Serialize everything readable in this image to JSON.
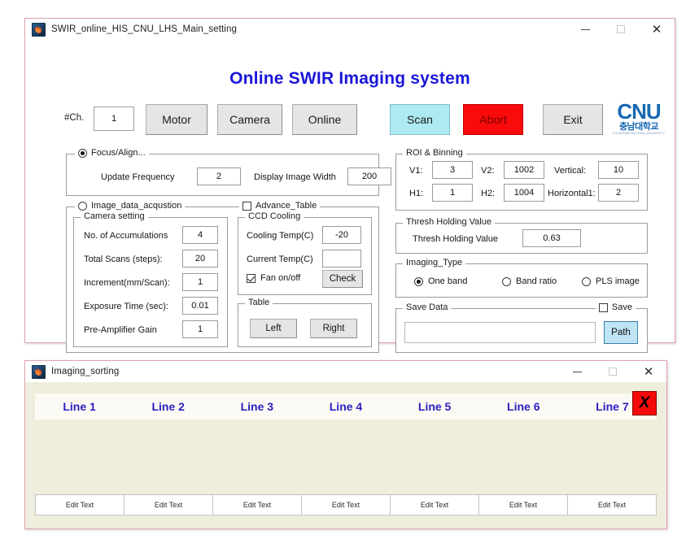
{
  "main_window": {
    "title": "SWIR_online_HIS_CNU_LHS_Main_setting",
    "app_title": "Online SWIR Imaging system",
    "controls": {
      "minimize": "–",
      "maximize": "□",
      "close": "✕"
    },
    "toolbar": {
      "ch_label": "#Ch.",
      "ch_value": "1",
      "motor": "Motor",
      "camera": "Camera",
      "online": "Online",
      "scan": "Scan",
      "abort": "Abort",
      "exit": "Exit"
    },
    "logo": {
      "main": "CNU",
      "korean": "충남대학교",
      "subtitle": "CHUNGNAM NATIONAL UNIVERSITY"
    },
    "focus_panel": {
      "title": "Focus/Align...",
      "selected": true,
      "update_frequency_label": "Update Frequency",
      "update_frequency_value": "2",
      "display_image_width_label": "Display Image Width",
      "display_image_width_value": "200"
    },
    "acquisition_panel": {
      "title": "Image_data_acqustion",
      "selected": false,
      "advance_table_label": "Advance_Table",
      "advance_table_checked": false,
      "camera_setting": {
        "title": "Camera setting",
        "rows": [
          {
            "label": "No. of Accumulations",
            "value": "4"
          },
          {
            "label": "Total Scans (steps):",
            "value": "20"
          },
          {
            "label": "Increment(mm/Scan):",
            "value": "1"
          },
          {
            "label": "Exposure Time (sec):",
            "value": "0.01"
          },
          {
            "label": "Pre-Amplifier Gain",
            "value": "1"
          }
        ]
      },
      "ccd_cooling": {
        "title": "CCD Cooling",
        "cooling_temp_label": "Cooling Temp(C)",
        "cooling_temp_value": "-20",
        "current_temp_label": "Current Temp(C)",
        "current_temp_value": "",
        "fan_label": "Fan on/off",
        "fan_checked": true,
        "check_button": "Check"
      },
      "table": {
        "title": "Table",
        "left_button": "Left",
        "right_button": "Right"
      }
    },
    "roi_panel": {
      "title": "ROI & Binning",
      "fields": [
        {
          "label": "V1:",
          "value": "3"
        },
        {
          "label": "V2:",
          "value": "1002"
        },
        {
          "label": "Vertical:",
          "value": "10"
        },
        {
          "label": "H1:",
          "value": "1"
        },
        {
          "label": "H2:",
          "value": "1004"
        },
        {
          "label": "Horizontal1:",
          "value": "2"
        }
      ]
    },
    "thresh_panel": {
      "title": "Thresh Holding Value",
      "label": "Thresh Holding Value",
      "value": "0.63"
    },
    "imaging_type_panel": {
      "title": "Imaging_Type",
      "options": [
        {
          "label": "One band",
          "selected": true
        },
        {
          "label": "Band ratio",
          "selected": false
        },
        {
          "label": "PLS image",
          "selected": false
        }
      ]
    },
    "save_panel": {
      "title": "Save Data",
      "save_label": "Save",
      "save_checked": false,
      "path_value": "",
      "path_button": "Path"
    }
  },
  "sorting_window": {
    "title": "Imaging_sorting",
    "controls": {
      "minimize": "–",
      "maximize": "□",
      "close": "✕"
    },
    "lines": [
      "Line 1",
      "Line 2",
      "Line 3",
      "Line 4",
      "Line 5",
      "Line 6",
      "Line 7"
    ],
    "close_button": "X",
    "edit_cells": [
      "Edit Text",
      "Edit Text",
      "Edit Text",
      "Edit Text",
      "Edit Text",
      "Edit Text",
      "Edit Text"
    ]
  },
  "colors": {
    "title_blue": "#1a16d8",
    "scan_cyan": "#aeeaf2",
    "abort_red": "#f90b0b",
    "line_blue": "#2a1fc0",
    "window_border": "#e0a3ad",
    "sorting_bg": "#efeddc"
  }
}
